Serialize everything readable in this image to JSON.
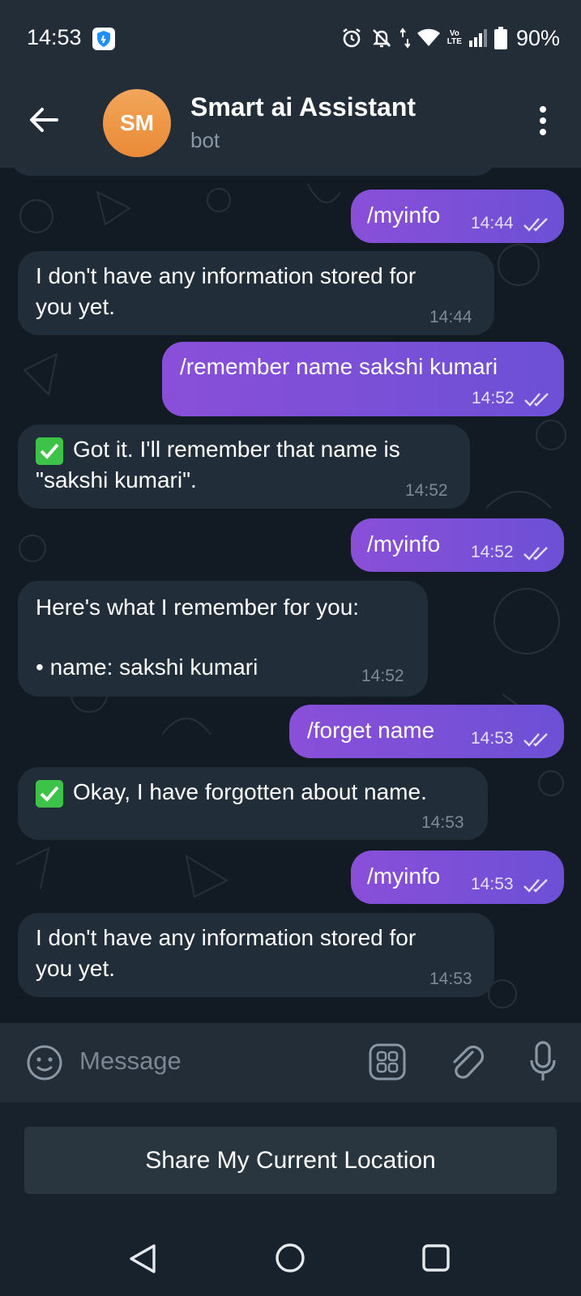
{
  "status_bar": {
    "time": "14:53",
    "lte_top": "Vo",
    "lte_bottom": "LTE",
    "battery": "90%"
  },
  "header": {
    "avatar_initials": "SM",
    "title": "Smart ai Assistant",
    "subtitle": "bot"
  },
  "messages": [
    {
      "dir": "in",
      "lines": [
        "I don't have any information stored for",
        "you yet."
      ],
      "time": "14:44"
    },
    {
      "dir": "out",
      "text": "/myinfo",
      "time": "14:44"
    },
    {
      "dir": "out",
      "text": "/remember name sakshi kumari",
      "time": "14:52"
    },
    {
      "dir": "in",
      "lines": [
        "Got it. I'll remember that name is",
        "\"sakshi kumari\"."
      ],
      "time": "14:52",
      "emoji": "check-mark"
    },
    {
      "dir": "out",
      "text": "/myinfo",
      "time": "14:52"
    },
    {
      "dir": "in",
      "lines": [
        "Here's what I remember for you:",
        "",
        "• name: sakshi kumari"
      ],
      "time": "14:52"
    },
    {
      "dir": "out",
      "text": "/forget name",
      "time": "14:53"
    },
    {
      "dir": "in",
      "lines": [
        "Okay, I have forgotten about name."
      ],
      "time": "14:53",
      "emoji": "check-mark"
    },
    {
      "dir": "out",
      "text": "/myinfo",
      "time": "14:53"
    },
    {
      "dir": "in",
      "lines": [
        "I don't have any information stored for",
        "you yet."
      ],
      "time": "14:53"
    }
  ],
  "input": {
    "placeholder": "Message",
    "value": ""
  },
  "keyboard": {
    "button_label": "Share My Current Location"
  },
  "colors": {
    "header_bg": "#222d38",
    "chat_bg": "#121b23",
    "incoming_bubble": "#212d39",
    "outgoing_bubble_start": "#8a4fd8",
    "outgoing_bubble_end": "#6c50d6",
    "avatar": "#ef9a48",
    "check_emoji": "#3cc348"
  },
  "icons": {
    "back": "arrow-left-icon",
    "more": "more-vertical-icon",
    "emoji": "smile-icon",
    "bot_keyboard": "keyboard-grid-icon",
    "attach": "paperclip-icon",
    "mic": "microphone-icon",
    "read": "double-check-icon"
  }
}
